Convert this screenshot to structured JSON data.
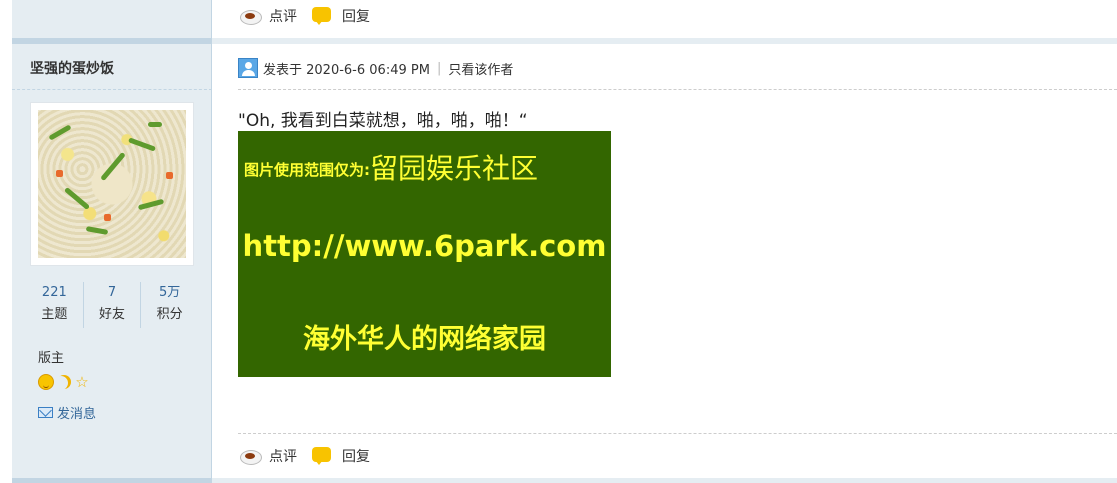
{
  "prev_post_actions": {
    "comment": "点评",
    "reply": "回复"
  },
  "author": {
    "name": "坚强的蛋炒饭",
    "stats": [
      {
        "value": "221",
        "label": "主题"
      },
      {
        "value": "7",
        "label": "好友"
      },
      {
        "value": "5万",
        "label": "积分"
      }
    ],
    "group": "版主",
    "medals": [
      "smile-medal-icon",
      "moon-medal-icon",
      "star-medal-icon"
    ],
    "send_message": "发消息"
  },
  "post": {
    "posted_at": "发表于 2020-6-6 06:49 PM",
    "only_author": "只看该作者",
    "text": "\"Oh, 我看到白菜就想，啪，啪，啪！“",
    "banner": {
      "line1_prefix": "图片使用范围仅为:",
      "line1_main": "留园娱乐社区",
      "line2": "http://www.6park.com",
      "line3": "海外华人的网络家园"
    },
    "actions": {
      "comment": "点评",
      "reply": "回复"
    }
  },
  "colors": {
    "sidebar_bg": "#e5edf2",
    "link": "#336699",
    "banner_bg": "#336600",
    "banner_text": "#ffff33"
  }
}
